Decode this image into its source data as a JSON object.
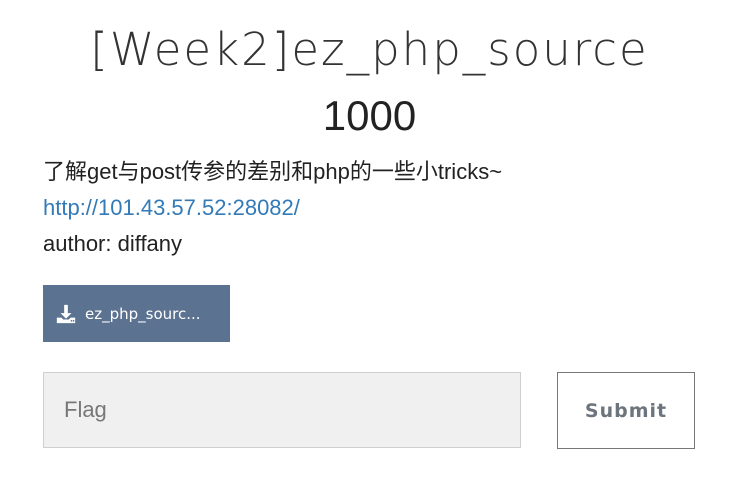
{
  "challenge": {
    "title": "[Week2]ez_php_source",
    "value": "1000",
    "description_line1": "了解get与post传参的差别和php的一些小tricks~",
    "link_text": "http://101.43.57.52:28082/",
    "author_line": "author: diffany"
  },
  "download": {
    "label": "ez_php_sourc...",
    "icon": "download-icon"
  },
  "flag_form": {
    "placeholder": "Flag",
    "value": "",
    "submit_label": "Submit"
  },
  "colors": {
    "download_button_bg": "#5b7290",
    "link": "#337ab7",
    "input_bg": "#f0f0f0"
  }
}
